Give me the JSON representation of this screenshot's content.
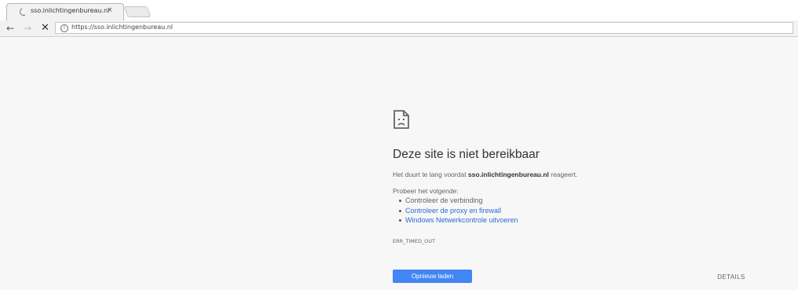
{
  "browser": {
    "tab": {
      "title": "sso.inlichtingenbureau.nl",
      "close_glyph": "×",
      "loading_icon": "loading-spinner-icon"
    },
    "toolbar": {
      "back_glyph": "←",
      "forward_glyph": "→",
      "stop_glyph": "✕",
      "info_glyph": "i",
      "url": "https://sso.inlichtingenbureau.nl"
    }
  },
  "error_page": {
    "icon": "sad-page-icon",
    "heading": "Deze site is niet bereikbaar",
    "description_prefix": "Het duurt te lang voordat ",
    "description_host": "sso.inlichtingenbureau.nl",
    "description_suffix": " reageert.",
    "suggestions_title": "Probeer het volgende:",
    "suggestions": [
      {
        "label": "Controleer de verbinding",
        "link": false
      },
      {
        "label": "Controleer de proxy en firewall",
        "link": true
      },
      {
        "label": "Windows Netwerkcontrole uitvoeren",
        "link": true
      }
    ],
    "error_code": "ERR_TIMED_OUT",
    "reload_label": "Opnieuw laden",
    "details_label": "DETAILS"
  },
  "colors": {
    "accent": "#4285f4",
    "link": "#2b6cd4",
    "page_background": "#f7f7f7"
  }
}
